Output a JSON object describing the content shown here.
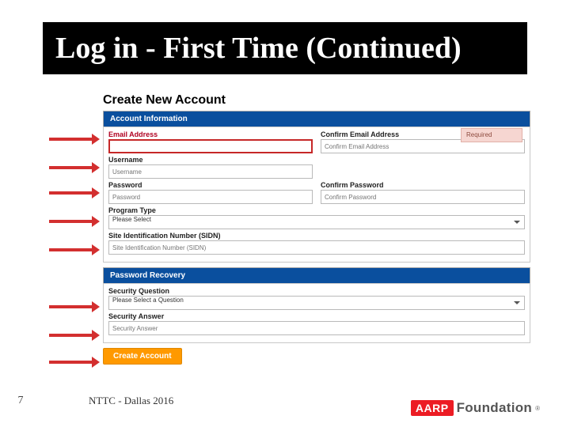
{
  "slide": {
    "title": "Log in - First Time (Continued)",
    "page_number": "7",
    "footer_text": "NTTC - Dallas 2016"
  },
  "logo": {
    "brand": "AARP",
    "sub": "Foundation",
    "reg": "®"
  },
  "form": {
    "heading": "Create New Account",
    "required_badge": "Required",
    "account_section": {
      "title": "Account Information",
      "email": {
        "label": "Email Address",
        "placeholder": ""
      },
      "confirm_email": {
        "label": "Confirm Email Address",
        "placeholder": "Confirm Email Address"
      },
      "username": {
        "label": "Username",
        "placeholder": "Username"
      },
      "password": {
        "label": "Password",
        "placeholder": "Password"
      },
      "confirm_password": {
        "label": "Confirm Password",
        "placeholder": "Confirm Password"
      },
      "program_type": {
        "label": "Program Type",
        "selected": "Please Select"
      },
      "sidn": {
        "label": "Site Identification Number (SIDN)",
        "placeholder": "Site Identification Number (SIDN)"
      }
    },
    "recovery_section": {
      "title": "Password Recovery",
      "question": {
        "label": "Security Question",
        "selected": "Please Select a Question"
      },
      "answer": {
        "label": "Security Answer",
        "placeholder": "Security Answer"
      }
    },
    "create_button": "Create Account"
  }
}
